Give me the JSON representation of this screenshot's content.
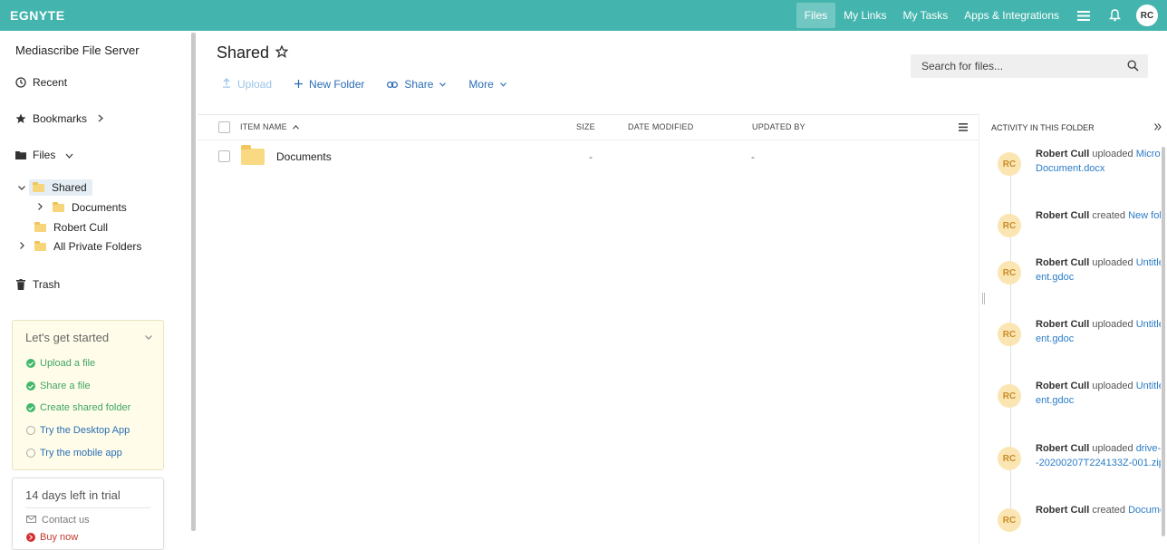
{
  "topbar": {
    "logo": "EGNYTE",
    "nav": [
      "Files",
      "My Links",
      "My Tasks",
      "Apps & Integrations"
    ],
    "active_nav": "Files",
    "avatar": "RC",
    "bg_color": "#44b5ae"
  },
  "sidebar": {
    "server_title": "Mediascribe File Server",
    "recent": "Recent",
    "bookmarks": "Bookmarks",
    "files": "Files",
    "tree": {
      "shared": "Shared",
      "documents": "Documents",
      "robert_cull": "Robert Cull",
      "all_private": "All Private Folders"
    },
    "trash": "Trash",
    "get_started": {
      "title": "Let's get started",
      "items": [
        {
          "label": "Upload a file",
          "done": true
        },
        {
          "label": "Share a file",
          "done": true
        },
        {
          "label": "Create shared folder",
          "done": true
        },
        {
          "label": "Try the Desktop App",
          "done": false
        },
        {
          "label": "Try the mobile app",
          "done": false
        }
      ]
    },
    "trial": {
      "title": "14 days left in trial",
      "contact": "Contact us",
      "buy": "Buy now"
    }
  },
  "main": {
    "title": "Shared",
    "toolbar": {
      "upload": "Upload",
      "new_folder": "New Folder",
      "share": "Share",
      "more": "More"
    },
    "search_placeholder": "Search for files...",
    "columns": {
      "name": "ITEM NAME",
      "size": "SIZE",
      "date": "DATE MODIFIED",
      "updated": "UPDATED BY"
    },
    "rows": [
      {
        "name": "Documents",
        "size": "-",
        "date": "",
        "updated_by": "-"
      }
    ]
  },
  "activity": {
    "title": "ACTIVITY IN THIS FOLDER",
    "items": [
      {
        "initials": "RC",
        "user": "Robert Cull",
        "action": "uploaded",
        "line1": "Micros",
        "line2": "Document.docx"
      },
      {
        "initials": "RC",
        "user": "Robert Cull",
        "action": "created",
        "line1": "New fold",
        "line2": ""
      },
      {
        "initials": "RC",
        "user": "Robert Cull",
        "action": "uploaded",
        "line1": "Untitle",
        "line2": "ent.gdoc"
      },
      {
        "initials": "RC",
        "user": "Robert Cull",
        "action": "uploaded",
        "line1": "Untitle",
        "line2": "ent.gdoc"
      },
      {
        "initials": "RC",
        "user": "Robert Cull",
        "action": "uploaded",
        "line1": "Untitle",
        "line2": "ent.gdoc"
      },
      {
        "initials": "RC",
        "user": "Robert Cull",
        "action": "uploaded",
        "line1": "drive-",
        "line2": "-20200207T224133Z-001.zip"
      },
      {
        "initials": "RC",
        "user": "Robert Cull",
        "action": "created",
        "line1": "Docume",
        "line2": ""
      }
    ]
  }
}
